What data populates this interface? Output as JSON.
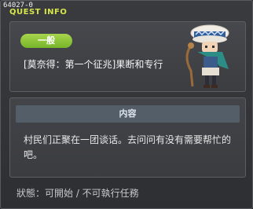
{
  "window": {
    "id_label": "64027-0",
    "title": "QUEST INFO"
  },
  "quest": {
    "category_badge": "一般",
    "name": "[莫奈得：第一个征兆]果断和专行"
  },
  "content": {
    "header": "内容",
    "description": "村民们正聚在一团谈话。去问问有没有需要帮忙的吧。"
  },
  "status": {
    "text": "狀態：可開始 / 不可執行任務"
  },
  "colors": {
    "title": "#d6e64a",
    "badge": "#8cc63e",
    "content_header_bg": "#545e69"
  }
}
